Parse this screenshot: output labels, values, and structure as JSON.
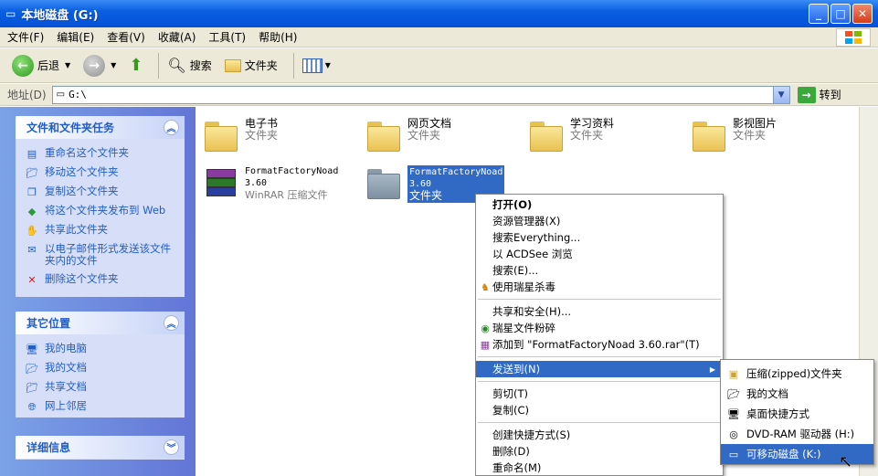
{
  "window": {
    "title": "本地磁盘 (G:)",
    "min": "_",
    "max": "□",
    "close": "✕"
  },
  "menubar": [
    "文件(F)",
    "编辑(E)",
    "查看(V)",
    "收藏(A)",
    "工具(T)",
    "帮助(H)"
  ],
  "toolbar": {
    "back": "后退",
    "search": "搜索",
    "folders": "文件夹"
  },
  "address": {
    "label": "地址(D)",
    "value": "G:\\",
    "go": "转到"
  },
  "left": {
    "tasks": {
      "title": "文件和文件夹任务",
      "items": [
        "重命名这个文件夹",
        "移动这个文件夹",
        "复制这个文件夹",
        "将这个文件夹发布到 Web",
        "共享此文件夹",
        "以电子邮件形式发送该文件夹内的文件",
        "删除这个文件夹"
      ]
    },
    "places": {
      "title": "其它位置",
      "items": [
        "我的电脑",
        "我的文档",
        "共享文档",
        "网上邻居"
      ]
    },
    "details": {
      "title": "详细信息"
    }
  },
  "files": [
    {
      "name": "电子书",
      "type": "文件夹"
    },
    {
      "name": "网页文档",
      "type": "文件夹"
    },
    {
      "name": "学习资料",
      "type": "文件夹"
    },
    {
      "name": "影视图片",
      "type": "文件夹"
    },
    {
      "name": "FormatFactoryNoad 3.60",
      "type": "WinRAR 压缩文件"
    },
    {
      "name": "FormatFactoryNoad 3.60",
      "type": "文件夹"
    }
  ],
  "context_menu": [
    "打开(O)",
    "资源管理器(X)",
    "搜索Everything...",
    "以 ACDSee 浏览",
    "搜索(E)...",
    "使用瑞星杀毒",
    "共享和安全(H)...",
    "瑞星文件粉碎",
    "添加到 \"FormatFactoryNoad 3.60.rar\"(T)",
    "发送到(N)",
    "剪切(T)",
    "复制(C)",
    "创建快捷方式(S)",
    "删除(D)",
    "重命名(M)"
  ],
  "sendto": [
    "压缩(zipped)文件夹",
    "我的文档",
    "桌面快捷方式",
    "DVD-RAM 驱动器 (H:)",
    "可移动磁盘 (K:)"
  ]
}
